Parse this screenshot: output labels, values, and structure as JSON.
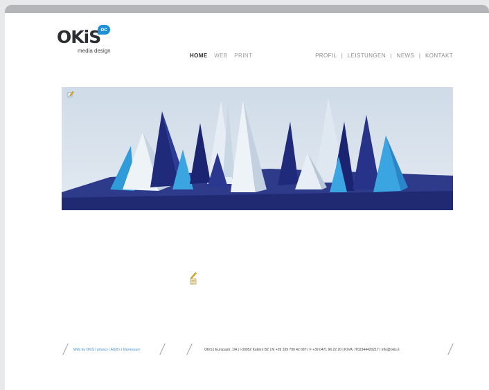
{
  "logo": {
    "text": "OKiS",
    "bubble": "oc",
    "subtitle": "media design"
  },
  "main_nav": [
    {
      "label": "HOME",
      "active": true
    },
    {
      "label": "WEB",
      "active": false
    },
    {
      "label": "PRINT",
      "active": false
    }
  ],
  "top_nav": [
    "PROFIL",
    "LEISTUNGEN",
    "NEWS",
    "KONTAKT"
  ],
  "top_nav_separator": "|",
  "footer": {
    "left": "Web by OKiS | privacy | AGB's | Impressum",
    "right": "OKiS | Europastr. 1/A | I-39052 Kaltern BZ | M +39 339 799 42 68T | F +39 0471 96 22 20 | P.IVA: IT02344420217 | info@okis.it"
  },
  "colors": {
    "brand": "#1e8fd6",
    "text_dark": "#2b2d31",
    "nav_muted": "#9a9ca0",
    "frame": "#b3b5b8"
  },
  "icons": {
    "banner_edit": "pencil-edit-icon",
    "content_edit": "pencil-icon",
    "content_note": "note-icon"
  }
}
